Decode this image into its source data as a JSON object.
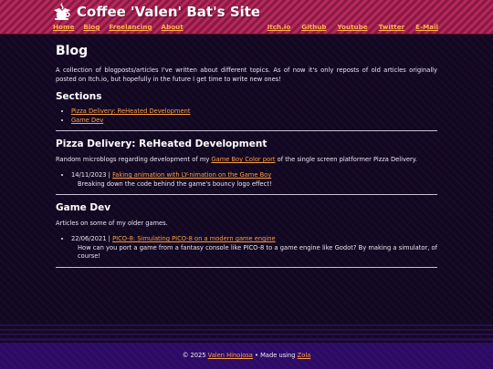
{
  "header": {
    "site_title": "Coffee 'Valen' Bat's Site",
    "nav_left": [
      "Home",
      "Blog",
      "Freelancing",
      "About"
    ],
    "nav_right": [
      "Itch.io",
      "Github",
      "Youtube",
      "Twitter",
      "E-Mail"
    ]
  },
  "page": {
    "title": "Blog",
    "intro": "A collection of blogposts/articles I've written about different topics. As of now it's only reposts of old articles originally posted on Itch.io, but hopefully in the future I get time to write new ones!",
    "sections_heading": "Sections",
    "sections_links": [
      "Pizza Delivery: ReHeated Development",
      "Game Dev"
    ]
  },
  "pizza": {
    "heading": "Pizza Delivery: ReHeated Development",
    "desc_before": "Random microblogs regarding development of my ",
    "desc_link": "Game Boy Color port",
    "desc_after": " of the single screen platformer Pizza Delivery.",
    "post": {
      "date": "14/11/2023",
      "separator": " | ",
      "link": "Faking animation with LY-nimation on the Game Boy",
      "summary": "Breaking down the code behind the game's bouncy logo effect!"
    }
  },
  "gamedev": {
    "heading": "Game Dev",
    "desc": "Articles on some of my older games.",
    "post": {
      "date": "22/06/2021",
      "separator": " | ",
      "link": "PICO-8: Simulating PICO-8 on a modern game engine",
      "summary": "How can you port a game from a fantasy console like PICO-8 to a game engine like Godot? By making a simulator, of course!"
    }
  },
  "footer": {
    "copyright": "© 2025 ",
    "author_link": "Valen Hinojosa",
    "made_using": " • Made using ",
    "engine_link": "Zola"
  },
  "colors": {
    "header_bg": "#a01f4f",
    "link": "#ff9f40",
    "nav_link": "#ffb04c",
    "page_bg": "#130823",
    "footer_bg": "#2c0a66"
  }
}
